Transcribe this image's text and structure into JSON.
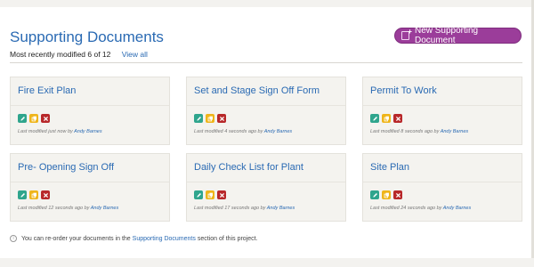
{
  "header": {
    "title": "Supporting Documents",
    "new_button_label": "New Supporting Document",
    "count_text": "Most recently modified 6 of 12",
    "view_all": "View all"
  },
  "cards": [
    {
      "title": "Fire Exit Plan",
      "modified": "Last modified just now by",
      "author": "Andy Barnes"
    },
    {
      "title": "Set and Stage Sign Off Form",
      "modified": "Last modified 4 seconds ago by",
      "author": "Andy Barnes"
    },
    {
      "title": "Permit To Work",
      "modified": "Last modified 8 seconds ago by",
      "author": "Andy Barnes"
    },
    {
      "title": "Pre- Opening Sign Off",
      "modified": "Last modified 12 seconds ago by",
      "author": "Andy Barnes"
    },
    {
      "title": "Daily Check List for Plant",
      "modified": "Last modified 17 seconds ago by",
      "author": "Andy Barnes"
    },
    {
      "title": "Site Plan",
      "modified": "Last modified 24 seconds ago by",
      "author": "Andy Barnes"
    }
  ],
  "footer": {
    "info_icon": "i",
    "note_before": "You can re-order your documents in the",
    "note_link": "Supporting Documents",
    "note_after": "section of this project."
  },
  "colors": {
    "accent": "#2a6ab3",
    "button": "#9b3d9a",
    "edit": "#2fa58d",
    "copy": "#efb51a",
    "delete": "#b8282a"
  },
  "icons": [
    "pencil-icon",
    "copy-icon",
    "close-icon",
    "new-document-icon",
    "info-icon"
  ]
}
